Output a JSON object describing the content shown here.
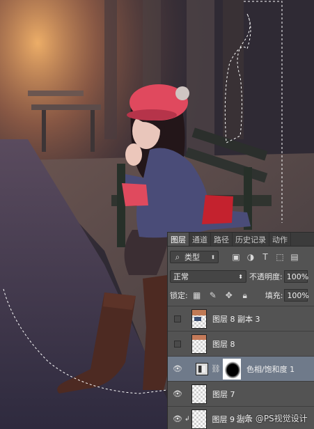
{
  "panel": {
    "tabs": [
      {
        "label": "图层",
        "active": true
      },
      {
        "label": "通道",
        "active": false
      },
      {
        "label": "路径",
        "active": false
      },
      {
        "label": "历史记录",
        "active": false
      },
      {
        "label": "动作",
        "active": false
      }
    ],
    "filter": {
      "label": "类型",
      "search_icon": "search-icon"
    },
    "filter_icons": [
      "image-filter-icon",
      "adjustment-filter-icon",
      "type-filter-icon",
      "shape-filter-icon",
      "smart-object-filter-icon"
    ],
    "blend_mode": "正常",
    "opacity_label": "不透明度:",
    "opacity_value": "100%",
    "lock_label": "锁定:",
    "lock_icons": [
      "lock-transparent-icon",
      "lock-brush-icon",
      "lock-move-icon",
      "lock-all-icon"
    ],
    "fill_label": "填充:",
    "fill_value": "100%",
    "layers": [
      {
        "name": "图层 8 副本 3",
        "visible": false,
        "selected": false,
        "kind": "pixel"
      },
      {
        "name": "图层 8",
        "visible": false,
        "selected": false,
        "kind": "pixel"
      },
      {
        "name": "色相/饱和度 1",
        "visible": true,
        "selected": true,
        "kind": "adjustment"
      },
      {
        "name": "图层 7",
        "visible": true,
        "selected": false,
        "kind": "pixel"
      },
      {
        "name": "图层 9 副本",
        "visible": true,
        "selected": false,
        "kind": "pixel"
      }
    ]
  },
  "watermark": "头条 @PS视觉设计",
  "colors": {
    "panel_bg": "#535353",
    "tab_bar": "#3b3b3b",
    "selected_layer": "#6f7a8a",
    "hat": "#e0495e",
    "sleeve": "#e04a5e",
    "dress": "#4a4c78",
    "belt": "#c4222e",
    "boots": "#4d2a22"
  }
}
